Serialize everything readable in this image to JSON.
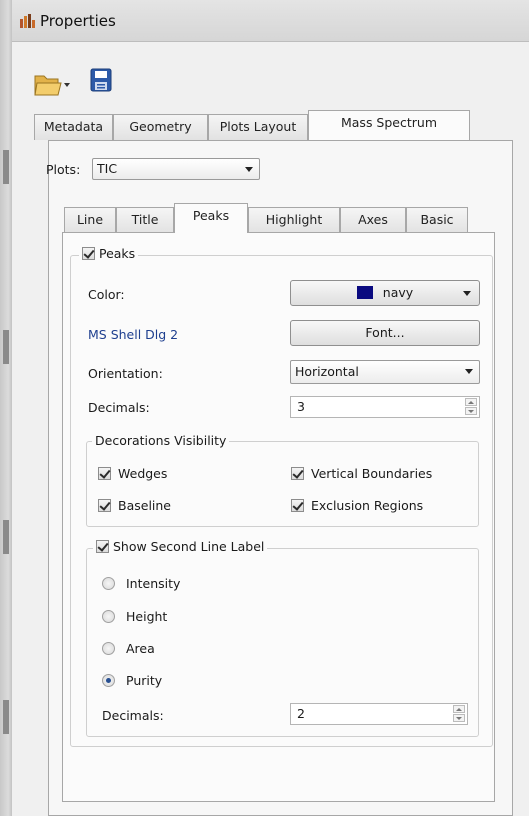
{
  "window": {
    "title": "Properties"
  },
  "main_tabs": [
    {
      "label": "Metadata"
    },
    {
      "label": "Geometry"
    },
    {
      "label": "Plots Layout"
    },
    {
      "label": "Mass Spectrum"
    }
  ],
  "plots": {
    "label": "Plots:",
    "value": "TIC"
  },
  "inner_tabs": [
    {
      "label": "Line"
    },
    {
      "label": "Title"
    },
    {
      "label": "Peaks"
    },
    {
      "label": "Highlight"
    },
    {
      "label": "Axes"
    },
    {
      "label": "Basic"
    }
  ],
  "peaks": {
    "group_label": "Peaks",
    "checked": true,
    "color_label": "Color:",
    "color_value": "navy",
    "color_hex": "#0a0a80",
    "font_name": "MS Shell Dlg 2",
    "font_button": "Font...",
    "orientation_label": "Orientation:",
    "orientation_value": "Horizontal",
    "decimals_label": "Decimals:",
    "decimals_value": "3"
  },
  "decorations": {
    "title": "Decorations Visibility",
    "items": [
      {
        "label": "Wedges",
        "checked": true
      },
      {
        "label": "Vertical Boundaries",
        "checked": true
      },
      {
        "label": "Baseline",
        "checked": true
      },
      {
        "label": "Exclusion Regions",
        "checked": true
      }
    ]
  },
  "second_line": {
    "title": "Show Second Line Label",
    "checked": true,
    "options": [
      {
        "label": "Intensity",
        "selected": false
      },
      {
        "label": "Height",
        "selected": false
      },
      {
        "label": "Area",
        "selected": false
      },
      {
        "label": "Purity",
        "selected": true
      }
    ],
    "decimals_label": "Decimals:",
    "decimals_value": "2"
  },
  "colors": {
    "link_blue": "#1e3f8f",
    "accent": "#274f91"
  }
}
